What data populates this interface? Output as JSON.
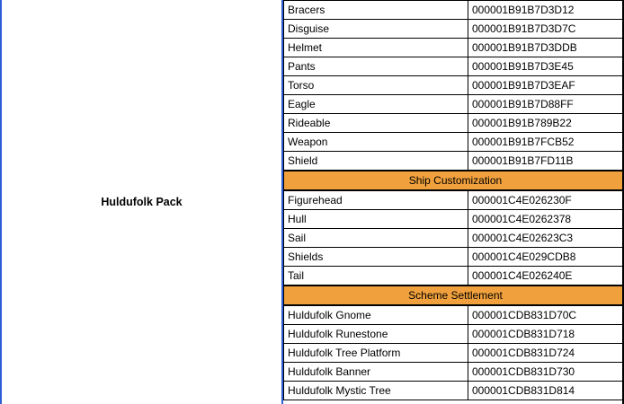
{
  "left": {
    "title": "Huldufolk Pack"
  },
  "rows": [
    {
      "type": "item",
      "name": "Bracers",
      "id": "000001B91B7D3D12"
    },
    {
      "type": "item",
      "name": "Disguise",
      "id": "000001B91B7D3D7C"
    },
    {
      "type": "item",
      "name": "Helmet",
      "id": "000001B91B7D3DDB"
    },
    {
      "type": "item",
      "name": "Pants",
      "id": "000001B91B7D3E45"
    },
    {
      "type": "item",
      "name": "Torso",
      "id": "000001B91B7D3EAF"
    },
    {
      "type": "item",
      "name": "Eagle",
      "id": "000001B91B7D88FF"
    },
    {
      "type": "item",
      "name": "Rideable",
      "id": "000001B91B789B22"
    },
    {
      "type": "item",
      "name": "Weapon",
      "id": "000001B91B7FCB52"
    },
    {
      "type": "item",
      "name": "Shield",
      "id": "000001B91B7FD11B"
    },
    {
      "type": "header",
      "name": "Ship Customization"
    },
    {
      "type": "item",
      "name": "Figurehead",
      "id": "000001C4E026230F"
    },
    {
      "type": "item",
      "name": "Hull",
      "id": "000001C4E0262378"
    },
    {
      "type": "item",
      "name": "Sail",
      "id": "000001C4E02623C3"
    },
    {
      "type": "item",
      "name": "Shields",
      "id": "000001C4E029CDB8"
    },
    {
      "type": "item",
      "name": "Tail",
      "id": "000001C4E026240E"
    },
    {
      "type": "header",
      "name": "Scheme Settlement"
    },
    {
      "type": "item",
      "name": "Huldufolk Gnome",
      "id": "000001CDB831D70C"
    },
    {
      "type": "item",
      "name": "Huldufolk Runestone",
      "id": "000001CDB831D718"
    },
    {
      "type": "item",
      "name": "Huldufolk Tree Platform",
      "id": "000001CDB831D724"
    },
    {
      "type": "item",
      "name": "Huldufolk Banner",
      "id": "000001CDB831D730"
    },
    {
      "type": "item",
      "name": "Huldufolk Mystic Tree",
      "id": "000001CDB831D814"
    }
  ]
}
